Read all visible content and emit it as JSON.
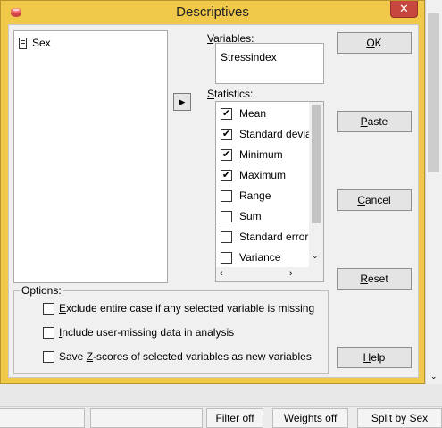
{
  "window": {
    "title": "Descriptives",
    "close_glyph": "✕"
  },
  "source_list": {
    "items": [
      {
        "label": "Sex",
        "icon": "variable-icon"
      }
    ]
  },
  "variables": {
    "label_u": "V",
    "label_rest": "ariables:",
    "items": [
      "Stressindex"
    ]
  },
  "move_button": {
    "glyph": "▶"
  },
  "statistics": {
    "label_u": "S",
    "label_rest": "tatistics:",
    "items": [
      {
        "label": "Mean",
        "checked": true
      },
      {
        "label": "Standard devia",
        "checked": true
      },
      {
        "label": "Minimum",
        "checked": true
      },
      {
        "label": "Maximum",
        "checked": true
      },
      {
        "label": "Range",
        "checked": false
      },
      {
        "label": "Sum",
        "checked": false
      },
      {
        "label": "Standard error",
        "checked": false
      },
      {
        "label": "Variance",
        "checked": false
      }
    ],
    "scroll_down": "⌄",
    "scroll_left": "‹",
    "scroll_right": "›"
  },
  "buttons": {
    "ok": {
      "u": "O",
      "rest": "K"
    },
    "paste": {
      "u": "P",
      "rest": "aste"
    },
    "cancel": {
      "u": "C",
      "rest": "ancel"
    },
    "reset": {
      "u": "R",
      "rest": "eset"
    },
    "help": {
      "u": "H",
      "rest": "elp"
    }
  },
  "options": {
    "legend": "Options:",
    "items": [
      {
        "pre": "",
        "u": "E",
        "post": "xclude entire case if any selected variable is missing",
        "checked": false
      },
      {
        "pre": "",
        "u": "I",
        "post": "nclude user-missing data in analysis",
        "checked": false
      },
      {
        "pre": "Save ",
        "u": "Z",
        "post": "-scores of selected variables as new variables",
        "checked": false
      }
    ]
  },
  "outer_scroll": {
    "down_glyph": "⌄"
  },
  "status_bar": {
    "filter": "Filter off",
    "weights": "Weights off",
    "split": "Split by Sex"
  },
  "colors": {
    "title_bar": "#f0c94a",
    "close": "#c7463d",
    "dialog_bg": "#f0f0f0"
  }
}
